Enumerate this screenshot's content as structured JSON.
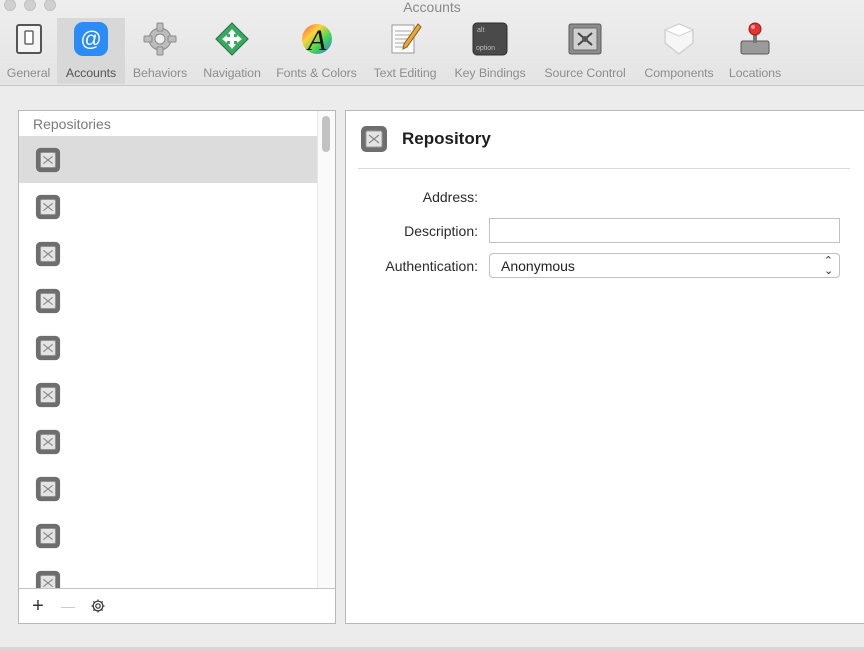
{
  "window": {
    "title": "Accounts"
  },
  "toolbar": {
    "items": [
      {
        "label": "General",
        "icon": "general-icon"
      },
      {
        "label": "Accounts",
        "icon": "accounts-icon",
        "selected": true
      },
      {
        "label": "Behaviors",
        "icon": "gear-icon"
      },
      {
        "label": "Navigation",
        "icon": "navigation-icon"
      },
      {
        "label": "Fonts & Colors",
        "icon": "fonts-colors-icon"
      },
      {
        "label": "Text Editing",
        "icon": "text-editing-icon"
      },
      {
        "label": "Key Bindings",
        "icon": "key-bindings-icon"
      },
      {
        "label": "Source Control",
        "icon": "source-control-icon"
      },
      {
        "label": "Components",
        "icon": "components-icon"
      },
      {
        "label": "Locations",
        "icon": "locations-icon"
      }
    ],
    "keycap": {
      "top": "alt",
      "bottom": "option"
    },
    "accent": "#2a8cf4"
  },
  "sidebar": {
    "header": "Repositories",
    "row_count": 10,
    "add_symbol": "+",
    "remove_symbol": "—"
  },
  "detail": {
    "title": "Repository",
    "address_label": "Address:",
    "description_label": "Description:",
    "description_value": "",
    "authentication_label": "Authentication:",
    "authentication_value": "Anonymous"
  }
}
